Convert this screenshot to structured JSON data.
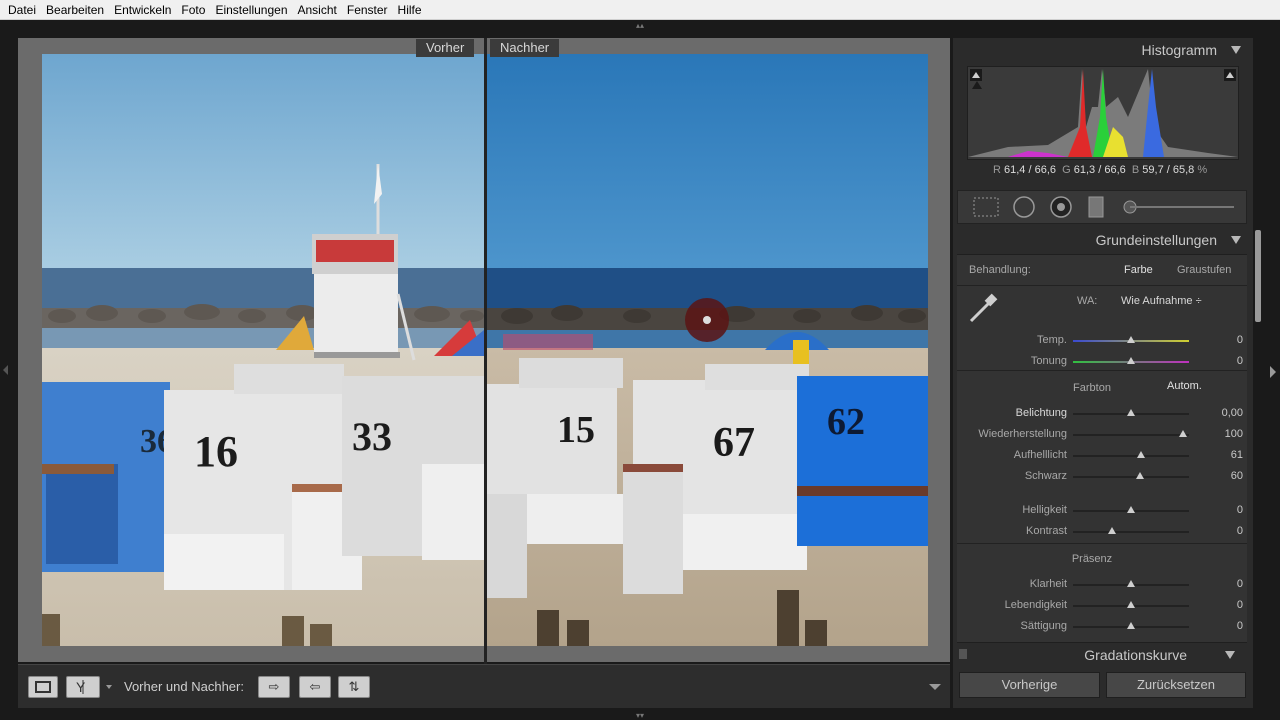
{
  "menu": [
    "Datei",
    "Bearbeiten",
    "Entwickeln",
    "Foto",
    "Einstellungen",
    "Ansicht",
    "Fenster",
    "Hilfe"
  ],
  "view": {
    "before_label": "Vorher",
    "after_label": "Nachher"
  },
  "toolbar": {
    "mode_label": "Vorher und Nachher:"
  },
  "histogram": {
    "title": "Histogramm",
    "r_label": "R",
    "r_value": "61,4 / 66,6",
    "g_label": "G",
    "g_value": "61,3 / 66,6",
    "b_label": "B",
    "b_value": "59,7 / 65,8",
    "pct": "%"
  },
  "basic": {
    "title": "Grundeinstellungen",
    "treatment_label": "Behandlung:",
    "treatment_color": "Farbe",
    "treatment_bw": "Graustufen",
    "wb_label": "WA:",
    "wb_value": "Wie Aufnahme ÷",
    "tone_title": "Farbton",
    "auto_label": "Autom.",
    "presence_title": "Präsenz",
    "sliders": [
      {
        "label": "Temp.",
        "value": "0",
        "pos": 0.5
      },
      {
        "label": "Tonung",
        "value": "0",
        "pos": 0.5
      },
      {
        "label": "Belichtung",
        "value": "0,00",
        "pos": 0.5
      },
      {
        "label": "Wiederherstellung",
        "value": "100",
        "pos": 0.95
      },
      {
        "label": "Aufhelllicht",
        "value": "61",
        "pos": 0.59
      },
      {
        "label": "Schwarz",
        "value": "60",
        "pos": 0.58
      },
      {
        "label": "Helligkeit",
        "value": "0",
        "pos": 0.5
      },
      {
        "label": "Kontrast",
        "value": "0",
        "pos": 0.34
      },
      {
        "label": "Klarheit",
        "value": "0",
        "pos": 0.5
      },
      {
        "label": "Lebendigkeit",
        "value": "0",
        "pos": 0.5
      },
      {
        "label": "Sättigung",
        "value": "0",
        "pos": 0.5
      }
    ]
  },
  "curve": {
    "title": "Gradationskurve"
  },
  "buttons": {
    "previous": "Vorherige",
    "reset": "Zurücksetzen"
  },
  "photo": {
    "before_numbers": [
      "36",
      "16",
      "33"
    ],
    "after_numbers": [
      "15",
      "67",
      "62"
    ]
  }
}
